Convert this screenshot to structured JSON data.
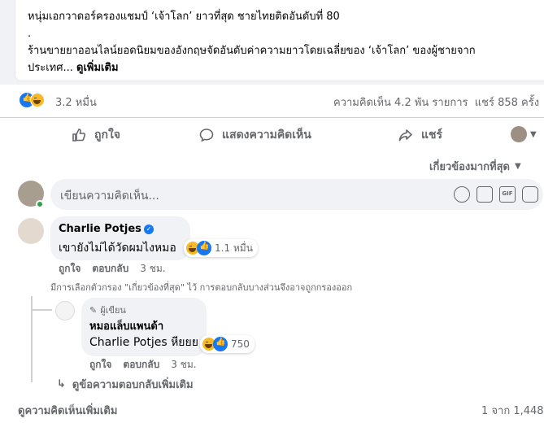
{
  "post": {
    "line1": "หนุ่มเอกวาดอร์ครองแชมป์ ‘เจ้าโลก’ ยาวที่สุด ชายไทยติดอันดับที่ 80",
    "line2": ".",
    "line3": "ร้านขายยาออนไลน์ยอดนิยมของอังกฤษจัดอันดับค่าความยาวโดยเฉลี่ยของ ‘เจ้าโลก’ ของผู้ชายจาก",
    "line4_start": "ประเทศ...",
    "see_more": "ดูเพิ่มเติม"
  },
  "stats": {
    "reactions_count": "3.2 หมื่น",
    "comments_shares": "ความคิดเห็น 4.2 พัน รายการ  แชร์ 858 ครั้ง"
  },
  "actions": {
    "like": "ถูกใจ",
    "comment": "แสดงความคิดเห็น",
    "share": "แชร์"
  },
  "sort": {
    "label": "เกี่ยวข้องมากที่สุด"
  },
  "composer": {
    "placeholder": "เขียนความคิดเห็น..."
  },
  "comments": [
    {
      "author": "Charlie Potjes",
      "text": "เขายังไม่ได้วัดผมไงหมอ",
      "reaction_count": "1.1 หมื่น",
      "like": "ถูกใจ",
      "reply": "ตอบกลับ",
      "time": "3 ชม."
    }
  ],
  "filter_notice": "มีการเลือกตัวกรอง \"เกี่ยวข้องที่สุด\" ไว้ การตอบกลับบางส่วนจึงอาจถูกกรองออก",
  "reply": {
    "badge": "ผู้เขียน",
    "author": "หมอแล็บแพนด้า",
    "mention": "Charlie Potjes",
    "text": " หียยย",
    "reaction_count": "750",
    "like": "ถูกใจ",
    "reply": "ตอบกลับ",
    "time": "3 ชม."
  },
  "more_replies": "ดูข้อความตอบกลับเพิ่มเติม",
  "footer": {
    "more_comments": "ดูความคิดเห็นเพิ่มเติม",
    "pagination": "1 จาก 1,448"
  }
}
